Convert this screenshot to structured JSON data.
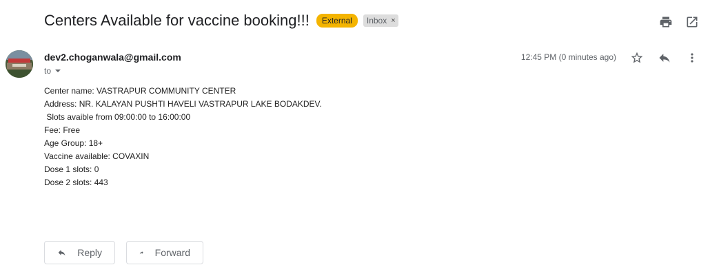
{
  "subject": "Centers Available for vaccine booking!!!",
  "labels": {
    "external": "External",
    "inbox": "Inbox",
    "inbox_remove": "×"
  },
  "top_icons": [
    "print-icon",
    "open-in-new-window-icon"
  ],
  "message": {
    "sender": "dev2.choganwala@gmail.com",
    "to_label": "to",
    "time": "12:45 PM (0 minutes ago)",
    "icons": [
      "star-icon",
      "reply-icon",
      "more-vert-icon"
    ],
    "body_lines": [
      "Center name: VASTRAPUR COMMUNITY CENTER",
      "Address: NR. KALAYAN PUSHTI HAVELI VASTRAPUR LAKE BODAKDEV.",
      " Slots avaible from 09:00:00 to 16:00:00",
      "Fee: Free",
      "Age Group: 18+",
      "Vaccine available: COVAXIN",
      "Dose 1 slots: 0",
      "Dose 2 slots: 443"
    ]
  },
  "actions": {
    "reply_label": "Reply",
    "forward_label": "Forward"
  },
  "colors": {
    "external_label_bg": "#f4b400",
    "inbox_label_bg": "#dddddd",
    "icon_grey": "#5f6368"
  }
}
